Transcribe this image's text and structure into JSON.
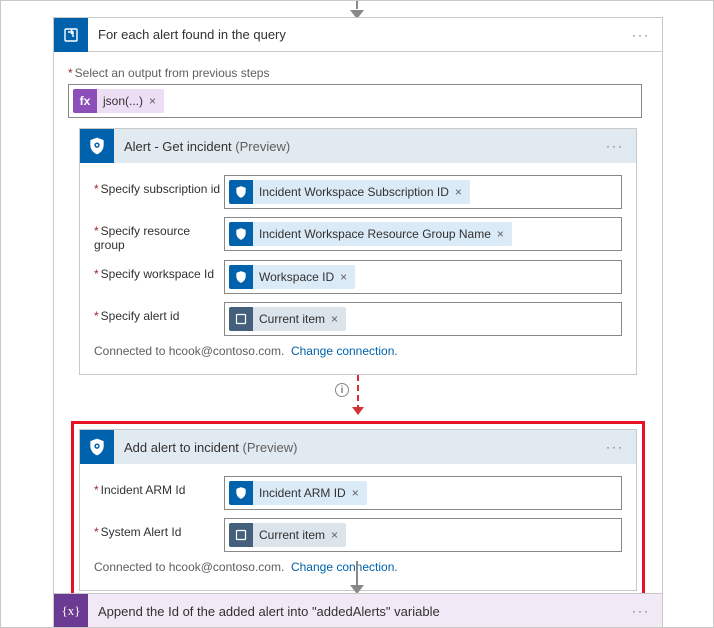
{
  "foreach": {
    "title": "For each alert found in the query",
    "select_label": "Select an output from previous steps",
    "token": "json(...)"
  },
  "get_incident": {
    "title": "Alert - Get incident",
    "preview": "(Preview)",
    "fields": {
      "sub": {
        "label": "Specify subscription id",
        "token": "Incident Workspace Subscription ID"
      },
      "rg": {
        "label": "Specify resource group",
        "token": "Incident Workspace Resource Group Name"
      },
      "ws": {
        "label": "Specify workspace Id",
        "token": "Workspace ID"
      },
      "alert": {
        "label": "Specify alert id",
        "token": "Current item"
      }
    },
    "connected": "Connected to hcook@contoso.com.",
    "change": "Change connection."
  },
  "add_alert": {
    "title": "Add alert to incident",
    "preview": "(Preview)",
    "fields": {
      "arm": {
        "label": "Incident ARM Id",
        "token": "Incident ARM ID"
      },
      "sysid": {
        "label": "System Alert Id",
        "token": "Current item"
      }
    },
    "connected": "Connected to hcook@contoso.com.",
    "change": "Change connection."
  },
  "append": {
    "title": "Append the Id of the added alert into \"addedAlerts\" variable"
  },
  "glyph": {
    "fx": "fx",
    "var": "{x}",
    "info": "i",
    "x": "×",
    "dots": "···"
  }
}
